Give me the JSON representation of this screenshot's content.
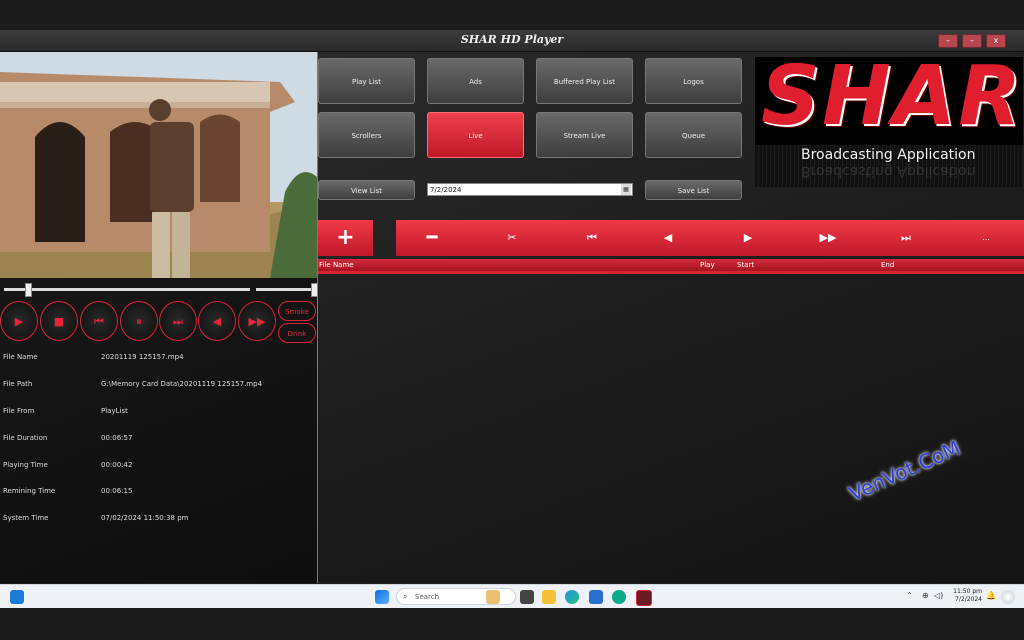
{
  "window": {
    "title": "SHAR HD Player",
    "min": "–",
    "restore": "–",
    "close": "x"
  },
  "player": {
    "smoke_label": "Smoke",
    "drink_label": "Drink"
  },
  "fileinfo": [
    {
      "label": "File Name",
      "value": "20201119 125157.mp4"
    },
    {
      "label": "File Path",
      "value": "G:\\Memory Card Data\\20201119 125157.mp4"
    },
    {
      "label": "File From",
      "value": "PlayList"
    },
    {
      "label": "File Duration",
      "value": "00:06:57"
    },
    {
      "label": "Playing Time",
      "value": "00:00:42"
    },
    {
      "label": "Remining Time",
      "value": "00:06:15"
    },
    {
      "label": "System Time",
      "value": "07/02/2024 11:50:38 pm"
    }
  ],
  "menu": {
    "row1": [
      "Play List",
      "Ads",
      "Buffered Play List",
      "Logos"
    ],
    "row2": [
      "Scrollers",
      "Live",
      "Stream Live",
      "Queue"
    ],
    "active": "Live",
    "view_list": "View List",
    "date_value": "7/2/2024",
    "save_list": "Save List"
  },
  "logo": {
    "name": "SHAR",
    "subtitle": "Broadcasting Application"
  },
  "toolbar": {
    "add": "+",
    "more": "..."
  },
  "list_headers": {
    "file_name": "File Name",
    "play": "Play",
    "start": "Start",
    "end": "End"
  },
  "watermark": "VenVot.CoM",
  "taskbar": {
    "search_placeholder": "Search",
    "time": "11:50 pm",
    "date": "7/2/2024"
  },
  "colors": {
    "accent": "#e8253a",
    "panel_border": "#4a8aa5"
  }
}
